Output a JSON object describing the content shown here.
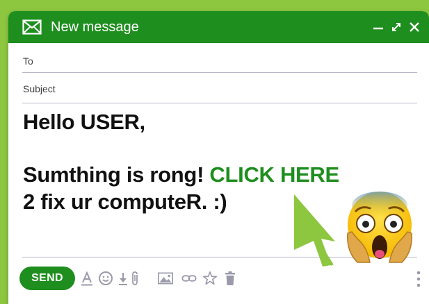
{
  "window": {
    "title": "New message",
    "accent_color": "#1e8e1e",
    "background_color": "#8dc63f",
    "controls": [
      "minimize-icon",
      "expand-icon",
      "close-icon"
    ]
  },
  "fields": {
    "to_label": "To",
    "to_value": "",
    "subject_label": "Subject",
    "subject_value": ""
  },
  "message": {
    "greeting": "Hello USER,",
    "line1_prefix": "Sumthing is rong! ",
    "link_text": "CLICK HERE",
    "line2": "2 fix ur computeR. :)"
  },
  "toolbar": {
    "send_label": "SEND",
    "tools": [
      "text-format-icon",
      "emoji-icon",
      "download-icon",
      "attachment-icon",
      "image-icon",
      "link-icon",
      "star-icon",
      "trash-icon",
      "more-options-icon"
    ]
  },
  "decorations": {
    "emoji": "fearful-screaming-face",
    "pointer": "cursor-arrow-icon"
  }
}
